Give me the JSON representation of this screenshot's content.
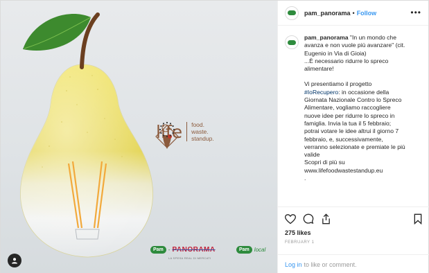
{
  "header": {
    "username": "pam_panorama",
    "separator": "•",
    "follow_label": "Follow",
    "more_label": "•••"
  },
  "media": {
    "life_word": "life",
    "life_tag_lines": [
      "food.",
      "waste.",
      "standup."
    ],
    "brand_pam": "Pam",
    "brand_dash": "-",
    "brand_panorama": "PANORAMA",
    "brand_panorama_sub": "LA SPESA REAL DI MERCATI",
    "brand_pam2": "Pam",
    "brand_local": "local",
    "colors": {
      "pear_yellow": "#e8d84a",
      "leaf_green": "#3d8a2e",
      "stem_brown": "#6b3f20",
      "bulb_filament": "#f2a93b",
      "life_brown": "#8b5a3c"
    }
  },
  "caption": {
    "username": "pam_panorama",
    "lines": [
      "\"In un mondo che",
      "avanza e non vuole più avanzare\" (cit.",
      "Eugenio in Via di Gioia)",
      "...È necessario ridurre lo spreco",
      "alimentare!"
    ],
    "para2_intro": "Vi presentiamo il progetto",
    "hashtag": "#IoRecupero",
    "para2_lines": [
      ": in occasione della",
      "Giornata Nazionale Contro lo Spreco",
      "Alimentare, vogliamo raccogliere",
      "nuove idee per ridurre lo spreco in",
      "famiglia. Invia la tua il 5 febbraio;",
      "potrai votare le idee altrui il giorno 7",
      "febbraio, e, successivamente,",
      "verranno selezionate e premiate le più",
      "valide",
      "Scopri di più su",
      "www.lifefoodwastestandup.eu",
      "."
    ]
  },
  "actions": {
    "likes": "275 likes",
    "date": "FEBRUARY 1"
  },
  "comment": {
    "login_label": "Log in",
    "rest": "to like or comment."
  }
}
